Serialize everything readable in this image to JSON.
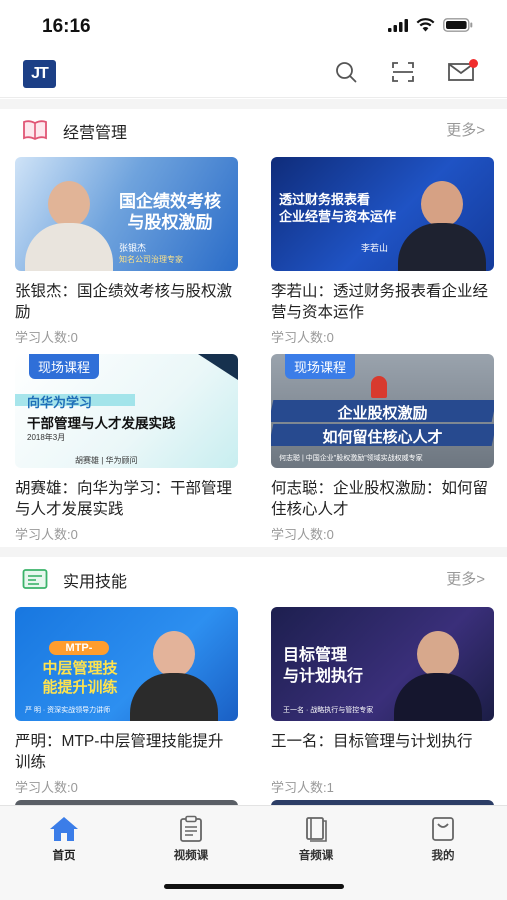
{
  "status_bar": {
    "time": "16:16"
  },
  "header": {
    "logo_text": "JT"
  },
  "sections": [
    {
      "title": "经营管理",
      "more": "更多>",
      "cards": [
        {
          "title": "张银杰：国企绩效考核与股权激励",
          "count": "学习人数:0",
          "thumb_text": "国企绩效考核\n与股权激励",
          "thumb_sub": "张银杰",
          "thumb_sub2": "知名公司治理专家"
        },
        {
          "title": "李若山：透过财务报表看企业经营与资本运作",
          "count": "学习人数:0",
          "thumb_text": "透过财务报表看\n企业经营与资本运作",
          "thumb_sub": "李若山"
        },
        {
          "title": "胡赛雄：向华为学习：干部管理与人才发展实践",
          "count": "学习人数:0",
          "tag": "现场课程",
          "thumb_text": "向华为学习",
          "thumb_text2": "干部管理与人才发展实践",
          "thumb_sub": "2018年3月",
          "thumb_sub2": "胡赛雄 | 华为顾问"
        },
        {
          "title": "何志聪：企业股权激励：如何留住核心人才",
          "count": "学习人数:0",
          "tag": "现场课程",
          "thumb_text": "企业股权激励",
          "thumb_text2": "如何留住核心人才",
          "thumb_sub": "何志聪 | 中国企业\"股权激励\"领域实战权威专家"
        }
      ]
    },
    {
      "title": "实用技能",
      "more": "更多>",
      "cards": [
        {
          "title": "严明：MTP-中层管理技能提升训练",
          "count": "学习人数:0",
          "thumb_text": "MTP-",
          "thumb_text2": "中层管理技\n能提升训练",
          "thumb_sub": "严 明 · 资深实战领导力讲师"
        },
        {
          "title": "王一名：目标管理与计划执行",
          "count": "学习人数:1",
          "thumb_text": "目标管理\n与计划执行",
          "thumb_sub": "王一名 · 战略执行与管控专家"
        }
      ]
    }
  ],
  "tabs": [
    {
      "label": "首页",
      "icon": "home-icon"
    },
    {
      "label": "视频课",
      "icon": "clipboard-icon"
    },
    {
      "label": "音频课",
      "icon": "book-icon"
    },
    {
      "label": "我的",
      "icon": "bag-icon"
    }
  ],
  "colors": {
    "accent": "#2f6fd8",
    "badge": "#f02d2d",
    "tab_active": "#3b7de8"
  }
}
